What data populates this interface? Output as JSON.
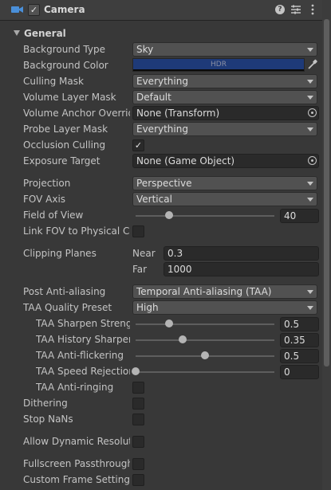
{
  "component": {
    "title": "Camera",
    "enabled_mark": "✓"
  },
  "section": {
    "title": "General"
  },
  "rows": {
    "background_type": {
      "label": "Background Type",
      "value": "Sky"
    },
    "background_color": {
      "label": "Background Color",
      "badge": "HDR",
      "color": "#1e3a78"
    },
    "culling_mask": {
      "label": "Culling Mask",
      "value": "Everything"
    },
    "volume_layer_mask": {
      "label": "Volume Layer Mask",
      "value": "Default"
    },
    "volume_anchor_override": {
      "label": "Volume Anchor Override",
      "value": "None (Transform)"
    },
    "probe_layer_mask": {
      "label": "Probe Layer Mask",
      "value": "Everything"
    },
    "occlusion_culling": {
      "label": "Occlusion Culling",
      "mark": "✓",
      "checked": true
    },
    "exposure_target": {
      "label": "Exposure Target",
      "value": "None (Game Object)"
    },
    "projection": {
      "label": "Projection",
      "value": "Perspective"
    },
    "fov_axis": {
      "label": "FOV Axis",
      "value": "Vertical"
    },
    "field_of_view": {
      "label": "Field of View",
      "value": "40",
      "fraction": 0.24
    },
    "link_fov": {
      "label": "Link FOV to Physical Camera",
      "checked": false
    },
    "clipping_planes": {
      "label": "Clipping Planes",
      "near_label": "Near",
      "near": "0.3",
      "far_label": "Far",
      "far": "1000"
    },
    "post_aa": {
      "label": "Post Anti-aliasing",
      "value": "Temporal Anti-aliasing (TAA)"
    },
    "taa_quality": {
      "label": "TAA Quality Preset",
      "value": "High"
    },
    "taa_sharpen": {
      "label": "TAA Sharpen Strength",
      "value": "0.5",
      "fraction": 0.24
    },
    "taa_history": {
      "label": "TAA History Sharpening",
      "value": "0.35",
      "fraction": 0.34
    },
    "taa_flicker": {
      "label": "TAA Anti-flickering",
      "value": "0.5",
      "fraction": 0.5
    },
    "taa_speed": {
      "label": "TAA Speed Rejection",
      "value": "0",
      "fraction": 0.0
    },
    "taa_ringing": {
      "label": "TAA Anti-ringing",
      "checked": false
    },
    "dithering": {
      "label": "Dithering",
      "checked": false
    },
    "stop_nans": {
      "label": "Stop NaNs",
      "checked": false
    },
    "dynamic_resolution": {
      "label": "Allow Dynamic Resolution",
      "checked": false
    },
    "fullscreen_passthrough": {
      "label": "Fullscreen Passthrough",
      "checked": false
    },
    "custom_frame": {
      "label": "Custom Frame Settings",
      "checked": false
    }
  },
  "icons": {
    "component": "camera-icon",
    "help": "help-icon",
    "presets": "presets-icon",
    "menu": "kebab-menu-icon",
    "eyedropper": "eyedropper-icon",
    "picker": "object-picker-icon"
  },
  "colors": {
    "accent": "#4a8fd9",
    "panel": "#383838"
  }
}
